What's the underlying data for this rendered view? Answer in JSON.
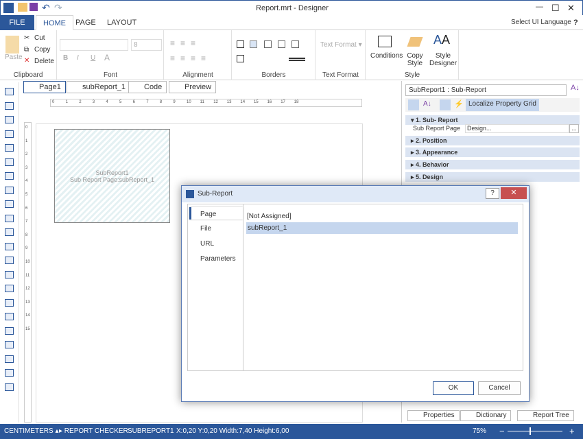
{
  "window": {
    "title": "Report.mrt - Designer",
    "minimize": "—",
    "maximize": "☐",
    "close": "✕"
  },
  "menu": {
    "tabs": [
      "FILE",
      "HOME",
      "PAGE",
      "LAYOUT"
    ],
    "language": "Select UI Language ▾",
    "help": "?"
  },
  "ribbon": {
    "clipboard": {
      "label": "Clipboard",
      "paste": "Paste",
      "cut": "Cut",
      "copy": "Copy",
      "delete": "Delete"
    },
    "font": {
      "label": "Font",
      "size": "8",
      "bold": "B",
      "italic": "I",
      "underline": "U",
      "color": "A"
    },
    "alignment": {
      "label": "Alignment"
    },
    "borders": {
      "label": "Borders"
    },
    "text_format": {
      "label": "Text Format",
      "dropdown": "Text Format ▾"
    },
    "style": {
      "label": "Style",
      "conditions": "Conditions",
      "copy_style": "Copy Style",
      "style_designer": "Style Designer"
    }
  },
  "doc_tabs": [
    "Page1",
    "subReport_1",
    "Code",
    "Preview"
  ],
  "ruler": [
    "0",
    "1",
    "2",
    "3",
    "4",
    "5",
    "6",
    "7",
    "8",
    "9",
    "10",
    "11",
    "12",
    "13",
    "14",
    "15",
    "16",
    "17",
    "18"
  ],
  "vruler": [
    "0",
    "1",
    "2",
    "3",
    "4",
    "5",
    "6",
    "7",
    "8",
    "9",
    "10",
    "11",
    "12",
    "13",
    "14",
    "15"
  ],
  "component": {
    "name": "SubReport1",
    "page": "Sub Report Page:subReport_1"
  },
  "properties": {
    "selector": "SubReport1 : Sub-Report",
    "localize": "Localize Property Grid",
    "categories": [
      "1. Sub- Report",
      "2. Position",
      "3. Appearance",
      "4. Behavior",
      "5. Design"
    ],
    "row": {
      "name": "Sub Report Page",
      "value": "Design...",
      "button": "..."
    }
  },
  "bottom_tabs": [
    "Properties",
    "Dictionary",
    "Report Tree"
  ],
  "dialog": {
    "title": "Sub-Report",
    "help": "?",
    "close": "✕",
    "nav": [
      "Page",
      "File",
      "URL",
      "Parameters"
    ],
    "list": [
      "[Not Assigned]",
      "subReport_1"
    ],
    "ok": "OK",
    "cancel": "Cancel"
  },
  "status": {
    "units": "CENTIMETERS ▴",
    "checker": "▸ REPORT CHECKER",
    "component": "SUBREPORT1",
    "coords": "X:0,20  Y:0,20  Width:7,40  Height:6,00",
    "zoom": "75%",
    "zoom_value": 75,
    "minus": "−",
    "plus": "+"
  },
  "colors": {
    "accent": "#2b579a",
    "selection": "#c5d6ee"
  }
}
